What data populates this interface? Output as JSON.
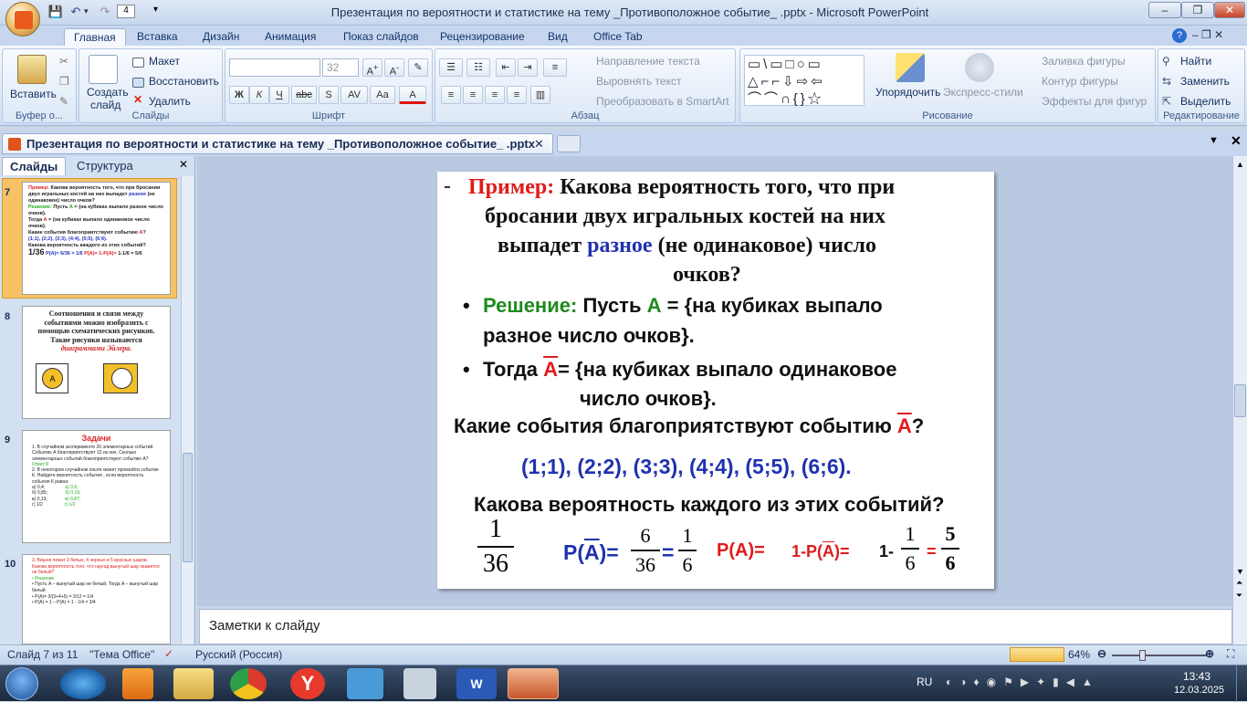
{
  "window": {
    "title": "Презентация по  вероятности и статистике на тему _Противоположное событие_ .pptx - Microsoft PowerPoint"
  },
  "quick_access": {
    "undo_count": "4"
  },
  "ribbon_tabs": [
    "Главная",
    "Вставка",
    "Дизайн",
    "Анимация",
    "Показ слайдов",
    "Рецензирование",
    "Вид",
    "Office Tab"
  ],
  "ribbon": {
    "clipboard": {
      "paste": "Вставить",
      "label": "Буфер о..."
    },
    "slides": {
      "create": "Создать",
      "create2": "слайд",
      "layout": "Макет",
      "reset": "Восстановить",
      "delete": "Удалить",
      "label": "Слайды"
    },
    "font": {
      "size": "32",
      "label": "Шрифт"
    },
    "paragraph": {
      "text_dir": "Направление текста",
      "align_text": "Выровнять текст",
      "smartart": "Преобразовать в SmartArt",
      "label": "Абзац"
    },
    "drawing": {
      "arrange": "Упорядочить",
      "quick_styles": "Экспресс-стили",
      "fill": "Заливка фигуры",
      "outline": "Контур фигуры",
      "effects": "Эффекты для фигур",
      "label": "Рисование"
    },
    "editing": {
      "find": "Найти",
      "replace": "Заменить",
      "select": "Выделить",
      "label": "Редактирование"
    }
  },
  "doc_tab": {
    "title": "Презентация по  вероятности и статистике на тему _Противоположное событие_ .pptx"
  },
  "panel_tabs": {
    "slides": "Слайды",
    "outline": "Структура"
  },
  "thumbnails": [
    {
      "num": "7"
    },
    {
      "num": "8",
      "text": "Соотношения и связи между событиями можно изобразить с помощью схематических рисунков. Такие рисунки называются",
      "italic": "диаграммами Эйлера."
    },
    {
      "num": "9",
      "title": "Задачи"
    },
    {
      "num": "10"
    }
  ],
  "slide": {
    "example_label": "Пример:",
    "q_line1": "Какова вероятность того,  что при",
    "q_line2": "бросании двух игральных костей на них",
    "q_line3a": "выпадет",
    "q_line3b": "разное",
    "q_line3c": "(не одинаковое) число",
    "q_line4": "очков?",
    "sol_label": "Решение:",
    "sol_text1": "Пусть",
    "A": "А",
    "sol_text2": "= {на кубиках выпало",
    "sol_text3": "разное число очков}.",
    "then_label": "Тогда",
    "then_text": "= {на кубиках выпало одинаковое",
    "then_text2": "число очков}.",
    "which_events": "Какие события благоприятствуют событию",
    "qmark": "?",
    "outcomes": "(1;1), (2;2), (3;3), (4;4), (5;5), (6;6).",
    "prob_each": "Какова вероятность каждого из этих событий?",
    "f1_num": "1",
    "f1_den": "36",
    "p_abar": "P(A)=",
    "f2_num": "6",
    "f2_den": "36",
    "eq": "=",
    "f3_num": "1",
    "f3_den": "6",
    "p_a": "P(A)=",
    "one_minus": "1-P(A)=",
    "one_minus2": "1-",
    "f4_num": "1",
    "f4_den": "6",
    "eq2": "=",
    "f5_num": "5",
    "f5_den": "6"
  },
  "notes": {
    "text": "Заметки к слайду"
  },
  "status": {
    "slide_info": "Слайд 7 из 11",
    "theme": "\"Тема Office\"",
    "lang": "Русский (Россия)",
    "zoom": "64%"
  },
  "taskbar": {
    "lang": "RU",
    "time": "13:43",
    "date": "12.03.2025"
  }
}
